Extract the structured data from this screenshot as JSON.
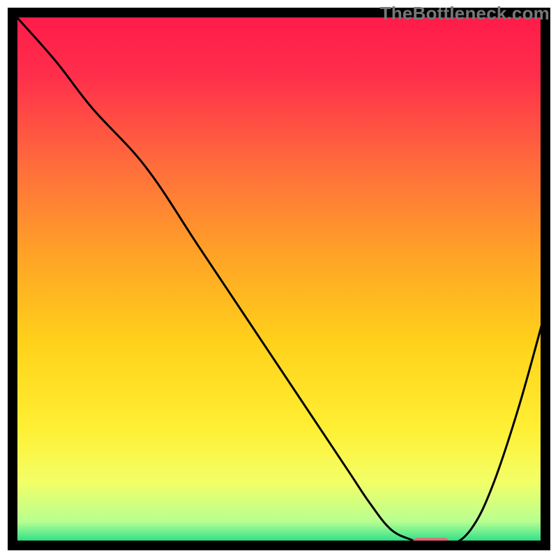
{
  "watermark": "TheBottleneck.com",
  "chart_data": {
    "type": "line",
    "title": "",
    "xlabel": "",
    "ylabel": "",
    "xlim": [
      0,
      100
    ],
    "ylim": [
      0,
      100
    ],
    "grid": false,
    "legend": false,
    "gradient_stops": [
      {
        "offset": 0.0,
        "color": "#ff1a4a"
      },
      {
        "offset": 0.12,
        "color": "#ff2f4b"
      },
      {
        "offset": 0.28,
        "color": "#ff6a3d"
      },
      {
        "offset": 0.45,
        "color": "#ffa127"
      },
      {
        "offset": 0.62,
        "color": "#ffd21a"
      },
      {
        "offset": 0.78,
        "color": "#ffef33"
      },
      {
        "offset": 0.88,
        "color": "#f3ff66"
      },
      {
        "offset": 0.955,
        "color": "#b8ff91"
      },
      {
        "offset": 0.985,
        "color": "#47e68c"
      },
      {
        "offset": 1.0,
        "color": "#0fd17a"
      }
    ],
    "series": [
      {
        "name": "bottleneck-curve",
        "stroke": "#000000",
        "stroke_width": 3,
        "x": [
          0,
          8,
          15,
          25,
          35,
          45,
          55,
          63,
          67,
          71,
          75,
          78,
          82,
          86,
          90,
          95,
          100
        ],
        "y": [
          100,
          91,
          82,
          71,
          56,
          41,
          26,
          14,
          8,
          3,
          1,
          0,
          0,
          3,
          11,
          26,
          44
        ]
      }
    ],
    "marker": {
      "name": "optimal-range-marker",
      "color": "#e9677a",
      "x_start": 75,
      "x_end": 82,
      "y": 0.3,
      "thickness": 2.2
    },
    "axes_box": {
      "stroke": "#000000",
      "stroke_width": 14
    }
  }
}
